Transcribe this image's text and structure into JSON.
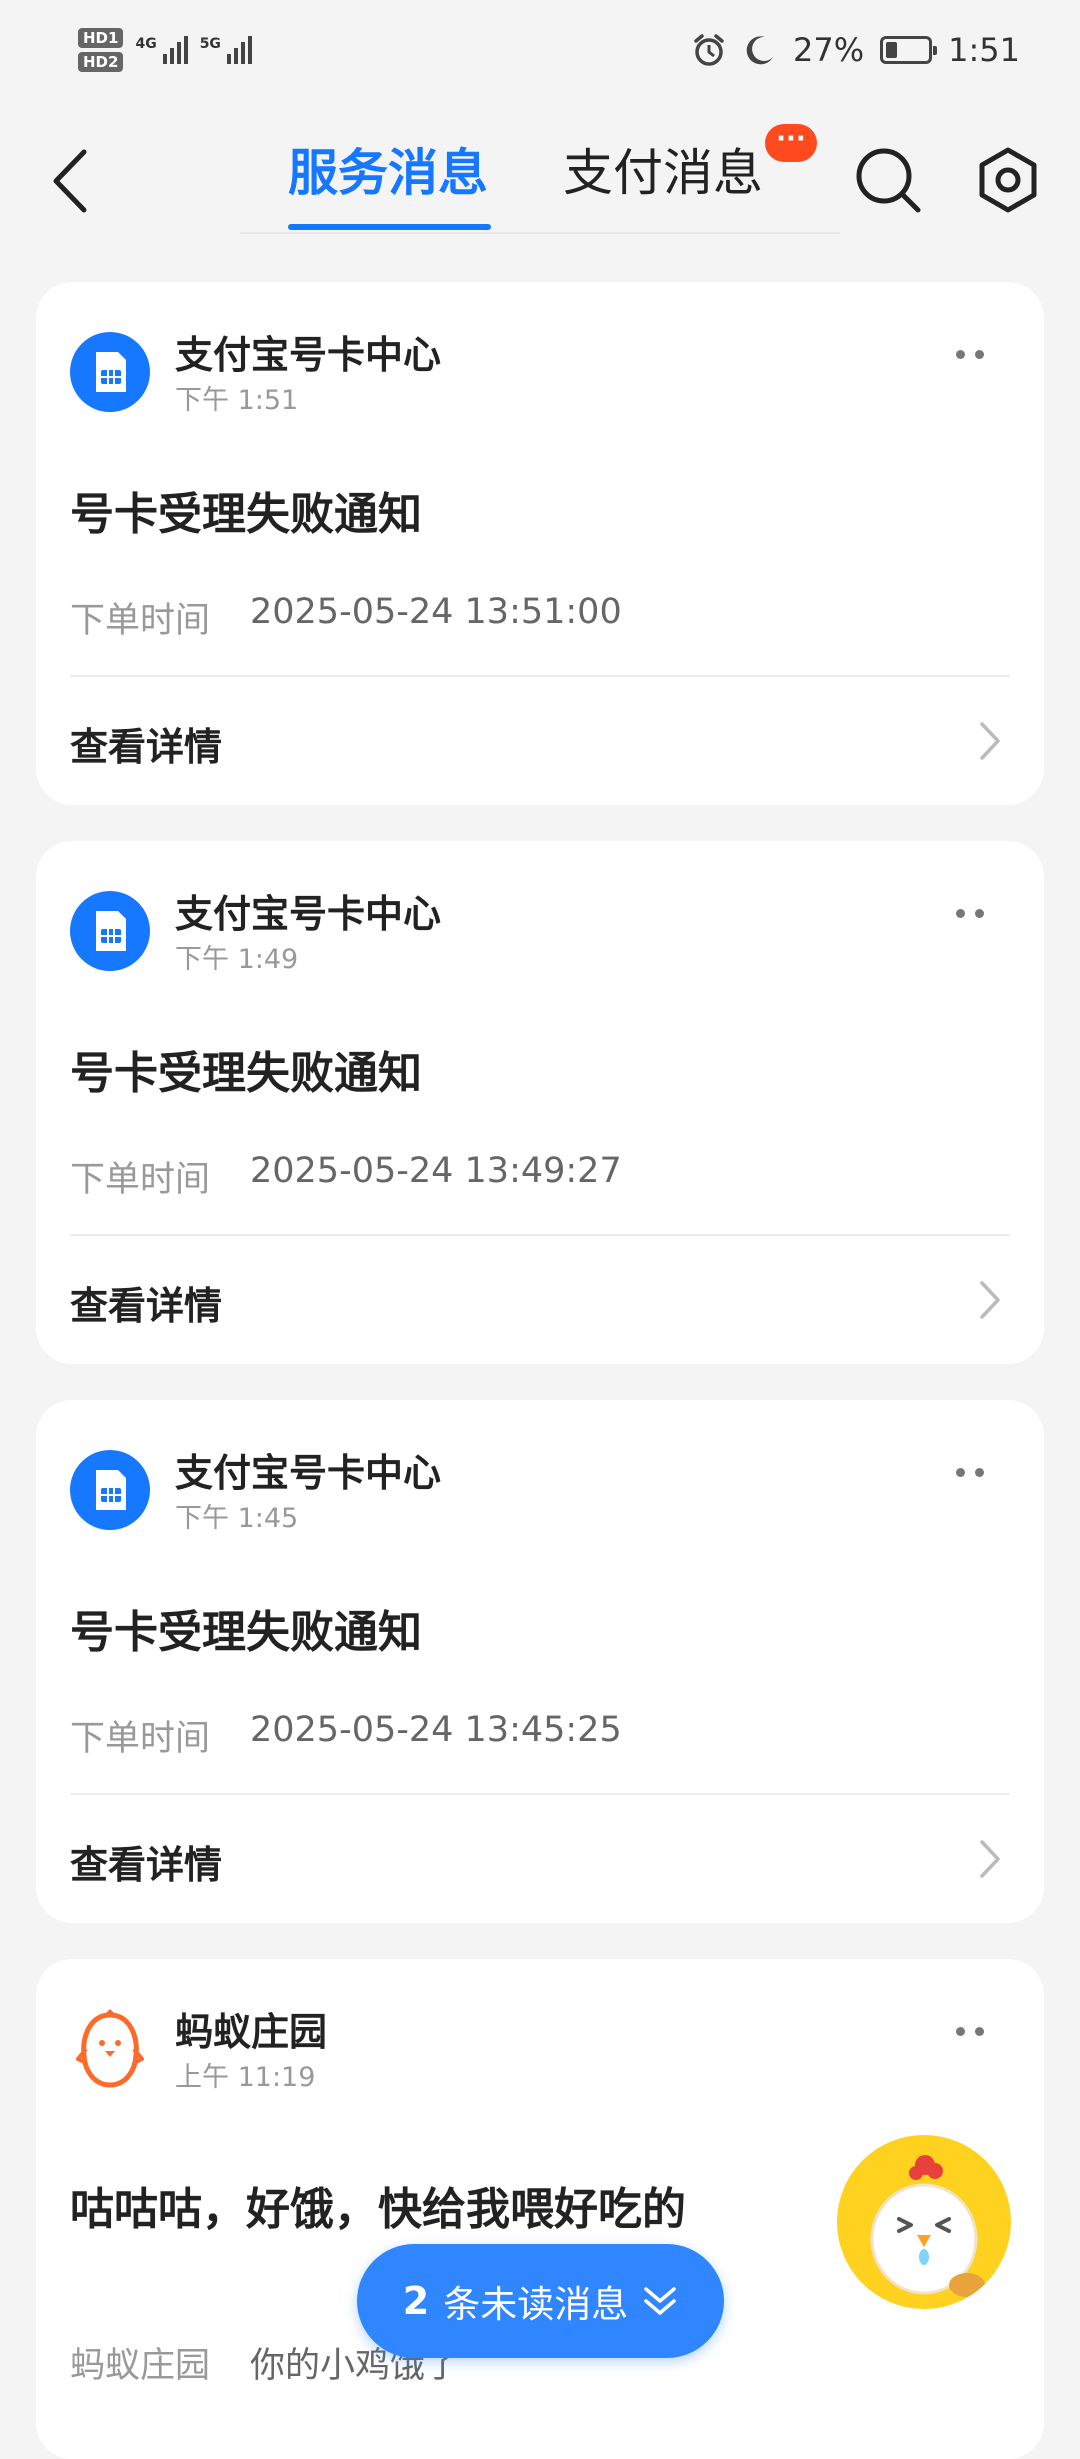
{
  "status_bar": {
    "network_1": "4G",
    "network_2": "5G",
    "hd_1": "HD1",
    "hd_2": "HD2",
    "battery_percent": "27%",
    "battery_level": 0.27,
    "time": "1:51",
    "icons": [
      "alarm-icon",
      "moon-icon",
      "battery-icon"
    ]
  },
  "header": {
    "tabs": [
      {
        "label": "服务消息",
        "active": true
      },
      {
        "label": "支付消息",
        "active": false,
        "badge": "···"
      }
    ],
    "accent_color": "#1677ff",
    "badge_color": "#ff4a1f"
  },
  "messages": [
    {
      "sender": "支付宝号卡中心",
      "time": "下午 1:51",
      "title": "号卡受理失败通知",
      "field_label": "下单时间",
      "field_value": "2025-05-24 13:51:00",
      "action": "查看详情"
    },
    {
      "sender": "支付宝号卡中心",
      "time": "下午 1:49",
      "title": "号卡受理失败通知",
      "field_label": "下单时间",
      "field_value": "2025-05-24 13:49:27",
      "action": "查看详情"
    },
    {
      "sender": "支付宝号卡中心",
      "time": "下午 1:45",
      "title": "号卡受理失败通知",
      "field_label": "下单时间",
      "field_value": "2025-05-24 13:45:25",
      "action": "查看详情"
    },
    {
      "sender": "蚂蚁庄园",
      "time": "上午 11:19",
      "title": "咕咕咕，好饿，快给我喂好吃的",
      "field_label": "蚂蚁庄园",
      "field_value": "你的小鸡饿了"
    }
  ],
  "unread": {
    "count": "2",
    "label": "条未读消息"
  }
}
